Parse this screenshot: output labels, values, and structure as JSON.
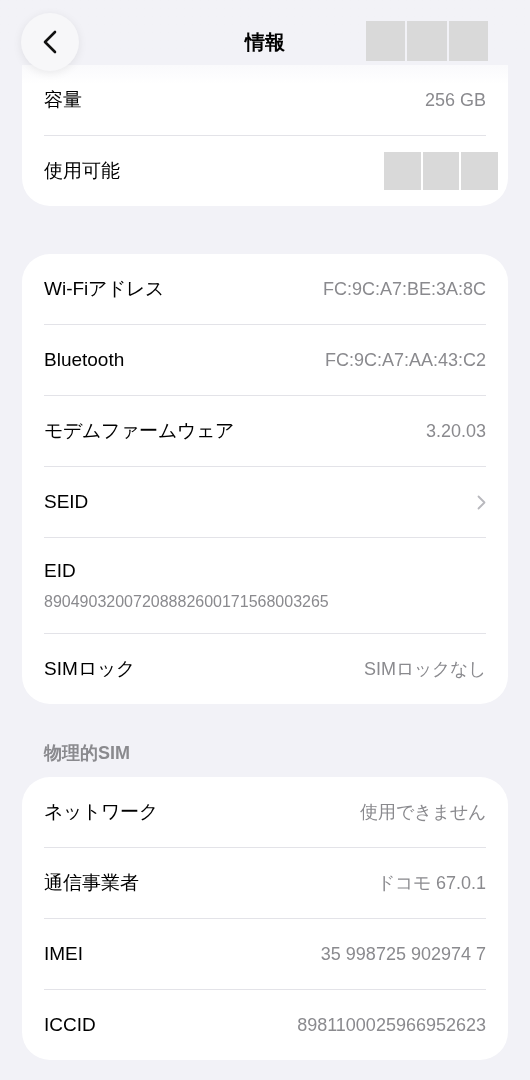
{
  "header": {
    "title": "情報"
  },
  "sections": [
    {
      "rows": [
        {
          "kind": "value",
          "label": "容量",
          "value": "256 GB"
        },
        {
          "kind": "redacted",
          "label": "使用可能"
        }
      ]
    },
    {
      "rows": [
        {
          "kind": "value",
          "label": "Wi-Fiアドレス",
          "value": "FC:9C:A7:BE:3A:8C"
        },
        {
          "kind": "value",
          "label": "Bluetooth",
          "value": "FC:9C:A7:AA:43:C2"
        },
        {
          "kind": "value",
          "label": "モデムファームウェア",
          "value": "3.20.03"
        },
        {
          "kind": "chevron",
          "label": "SEID"
        },
        {
          "kind": "stacked",
          "label": "EID",
          "value": "89049032007208882600171568003265"
        },
        {
          "kind": "value",
          "label": "SIMロック",
          "value": "SIMロックなし"
        }
      ]
    },
    {
      "title": "物理的SIM",
      "rows": [
        {
          "kind": "value",
          "label": "ネットワーク",
          "value": "使用できません"
        },
        {
          "kind": "value",
          "label": "通信事業者",
          "value": "ドコモ 67.0.1"
        },
        {
          "kind": "value",
          "label": "IMEI",
          "value": "35 998725 902974 7"
        },
        {
          "kind": "value",
          "label": "ICCID",
          "value": "8981100025966952623"
        }
      ]
    }
  ]
}
